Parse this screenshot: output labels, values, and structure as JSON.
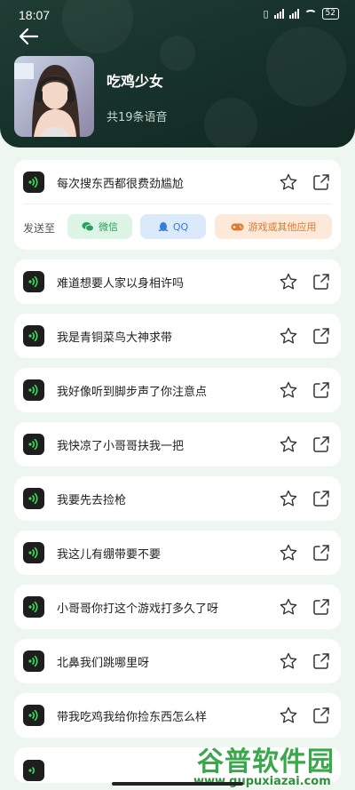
{
  "statusbar": {
    "time": "18:07",
    "battery": "52"
  },
  "header": {
    "title": "吃鸡少女",
    "count": "共19条语音"
  },
  "send_bar": {
    "label": "发送至",
    "wechat": "微信",
    "qq": "QQ",
    "game": "游戏或其他应用"
  },
  "items": [
    {
      "text": "每次搜东西都很费劲尴尬"
    },
    {
      "text": "难道想要人家以身相许吗"
    },
    {
      "text": "我是青铜菜鸟大神求带"
    },
    {
      "text": "我好像听到脚步声了你注意点"
    },
    {
      "text": "我快凉了小哥哥扶我一把"
    },
    {
      "text": "我要先去捡枪"
    },
    {
      "text": "我这儿有绷带要不要"
    },
    {
      "text": "小哥哥你打这个游戏打多久了呀"
    },
    {
      "text": "北鼻我们跳哪里呀"
    },
    {
      "text": "带我吃鸡我给你捡东西怎么样"
    }
  ],
  "watermark": {
    "brand": "谷普软件园",
    "url": "www.gupuxiazai.com"
  },
  "colors": {
    "header_bg": "#1b362f",
    "page_bg": "#eef6f0",
    "voice_green": "#39e05a"
  }
}
